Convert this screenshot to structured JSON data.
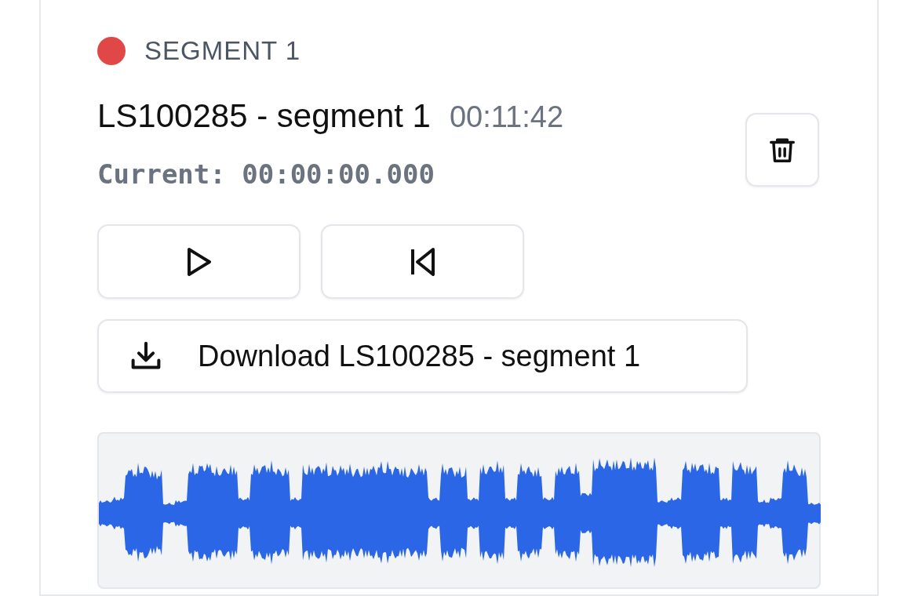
{
  "segment": {
    "label": "SEGMENT 1",
    "color": "#e04848",
    "title": "LS100285 - segment 1",
    "duration": "00:11:42",
    "current": "Current: 00:00:00.000",
    "download_label": "Download LS100285 - segment 1"
  }
}
